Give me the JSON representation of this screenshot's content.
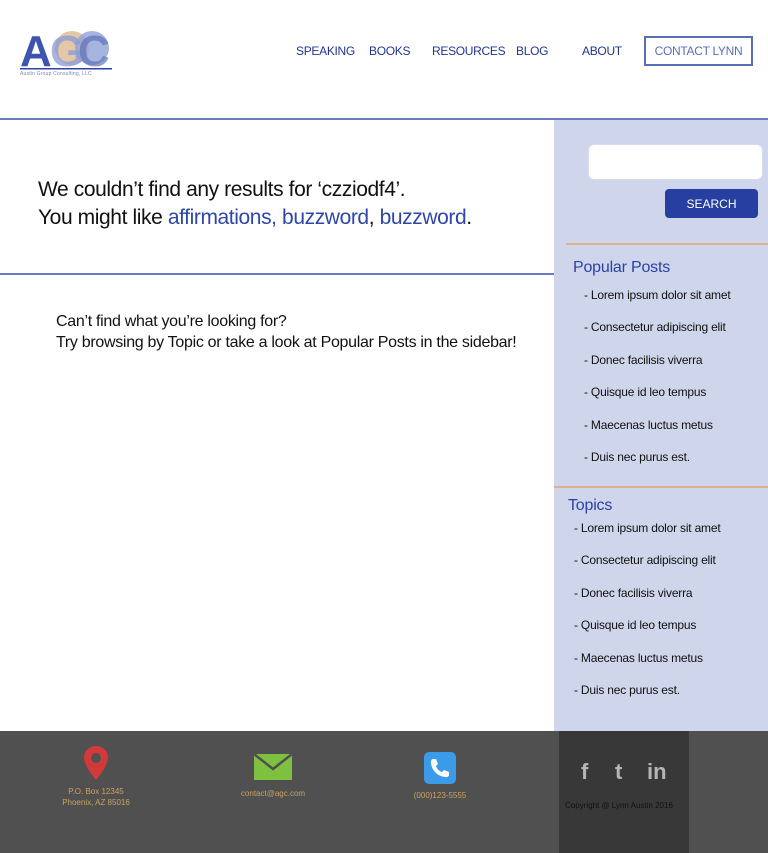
{
  "header": {
    "logo_letters": "AGC",
    "logo_tagline": "Austin Group Consulting, LLC",
    "nav": [
      {
        "label": "SPEAKING"
      },
      {
        "label": "BOOKS"
      },
      {
        "label": "RESOURCES"
      },
      {
        "label": "BLOG"
      },
      {
        "label": "ABOUT"
      }
    ],
    "contact_button": "CONTACT LYNN"
  },
  "main": {
    "no_results_line1": "We couldn’t find any results for ‘czziodf4’.",
    "suggest_prefix": "You might like ",
    "suggestions": [
      "affirmations, buzzword",
      "buzzword"
    ],
    "suggest_separator": ", ",
    "suggest_end": ".",
    "hint_line1": "Can’t find what you’re looking for?",
    "hint_line2": "Try browsing by Topic or take a look at Popular Posts in the sidebar!"
  },
  "sidebar": {
    "search": {
      "value": "",
      "button_label": "SEARCH"
    },
    "popular_posts": {
      "heading": "Popular Posts",
      "items": [
        "- Lorem ipsum dolor sit amet",
        "- Consectetur adipiscing elit",
        "- Donec facilisis viverra",
        "- Quisque id leo tempus",
        "- Maecenas luctus metus",
        "- Duis nec purus est."
      ]
    },
    "topics": {
      "heading": "Topics",
      "items": [
        "- Lorem ipsum dolor sit amet",
        "- Consectetur adipiscing elit",
        "- Donec facilisis viverra",
        "- Quisque id leo tempus",
        "- Maecenas luctus metus",
        "- Duis nec purus est."
      ]
    }
  },
  "footer": {
    "address_line1": "P.O. Box 12345",
    "address_line2": "Phoenix, AZ 85016",
    "email": "contact@agc.com",
    "phone": "(000)123-5555",
    "social": {
      "facebook": "f",
      "twitter": "t",
      "linkedin": "in"
    },
    "copyright": "Copyright @ Lynn Austin 2016"
  },
  "colors": {
    "brand_blue": "#2b42a6",
    "sidebar_bg": "#cfd5ea",
    "footer_bg": "#505050",
    "accent_tan": "#d9b48a",
    "pin_red": "#d23a3a",
    "mail_green": "#7dc13f",
    "phone_blue": "#3b9be8"
  }
}
